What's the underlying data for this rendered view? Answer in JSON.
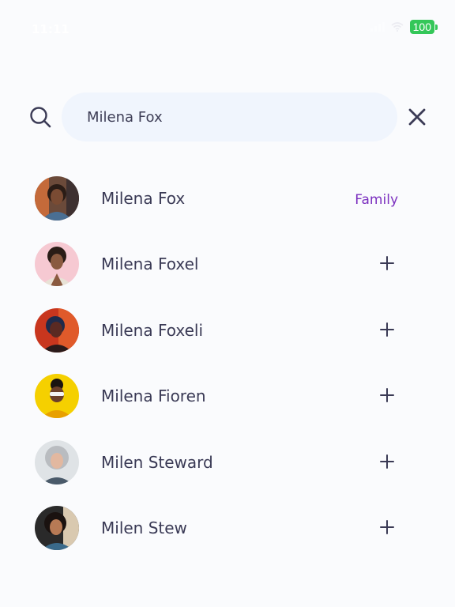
{
  "status_bar": {
    "time": "11:11",
    "battery": "100",
    "battery_color": "#34c759"
  },
  "search": {
    "value": "Milena Fox",
    "icon": "search-icon",
    "clear_icon": "close-icon"
  },
  "contacts": [
    {
      "name": "Milena Fox",
      "tag": "Family",
      "action_icon": null
    },
    {
      "name": "Milena Foxel",
      "tag": null,
      "action_icon": "plus-icon"
    },
    {
      "name": "Milena Foxeli",
      "tag": null,
      "action_icon": "plus-icon"
    },
    {
      "name": "Milena Fioren",
      "tag": null,
      "action_icon": "plus-icon"
    },
    {
      "name": "Milen Steward",
      "tag": null,
      "action_icon": "plus-icon"
    },
    {
      "name": "Milen Stew",
      "tag": null,
      "action_icon": "plus-icon"
    }
  ],
  "colors": {
    "accent_tag": "#7b2fbf",
    "text": "#3a3a55",
    "search_bg": "#f0f5fd"
  }
}
